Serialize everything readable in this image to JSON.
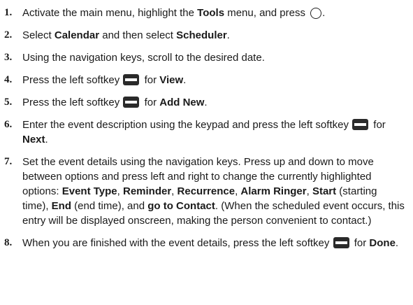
{
  "steps": [
    {
      "num": "1.",
      "parts": [
        {
          "t": "Activate the main menu, highlight the "
        },
        {
          "t": "Tools",
          "b": true
        },
        {
          "t": " menu, and press "
        },
        {
          "icon": "ok-key-icon"
        },
        {
          "t": "."
        }
      ]
    },
    {
      "num": "2.",
      "parts": [
        {
          "t": "Select "
        },
        {
          "t": "Calendar",
          "b": true
        },
        {
          "t": " and then select "
        },
        {
          "t": "Scheduler",
          "b": true
        },
        {
          "t": "."
        }
      ]
    },
    {
      "num": "3.",
      "parts": [
        {
          "t": "Using the navigation keys, scroll to the desired date."
        }
      ]
    },
    {
      "num": "4.",
      "parts": [
        {
          "t": "Press the left softkey "
        },
        {
          "icon": "left-softkey-icon"
        },
        {
          "t": " for "
        },
        {
          "t": "View",
          "b": true
        },
        {
          "t": "."
        }
      ]
    },
    {
      "num": "5.",
      "parts": [
        {
          "t": "Press the left softkey "
        },
        {
          "icon": "left-softkey-icon"
        },
        {
          "t": " for "
        },
        {
          "t": "Add New",
          "b": true
        },
        {
          "t": "."
        }
      ]
    },
    {
      "num": "6.",
      "parts": [
        {
          "t": "Enter the event description using the keypad and press the left softkey "
        },
        {
          "icon": "left-softkey-icon"
        },
        {
          "t": " for "
        },
        {
          "t": "Next",
          "b": true
        },
        {
          "t": "."
        }
      ]
    },
    {
      "num": "7.",
      "parts": [
        {
          "t": "Set the event details using the navigation keys. Press up and down to move between options and press left and right to change the currently highlighted options: "
        },
        {
          "t": "Event Type",
          "b": true
        },
        {
          "t": ", "
        },
        {
          "t": "Reminder",
          "b": true
        },
        {
          "t": ", "
        },
        {
          "t": "Recurrence",
          "b": true
        },
        {
          "t": ", "
        },
        {
          "t": "Alarm Ringer",
          "b": true
        },
        {
          "t": ", "
        },
        {
          "t": "Start",
          "b": true
        },
        {
          "t": " (starting time), "
        },
        {
          "t": "End",
          "b": true
        },
        {
          "t": " (end time), and "
        },
        {
          "t": "go to Contact",
          "b": true
        },
        {
          "t": ". (When the scheduled event occurs, this entry will be displayed onscreen, making the person convenient to contact.)"
        }
      ]
    },
    {
      "num": "8.",
      "parts": [
        {
          "t": "When you are finished with the event details, press the left softkey "
        },
        {
          "icon": "left-softkey-icon"
        },
        {
          "t": " for "
        },
        {
          "t": "Done",
          "b": true
        },
        {
          "t": "."
        }
      ]
    }
  ]
}
